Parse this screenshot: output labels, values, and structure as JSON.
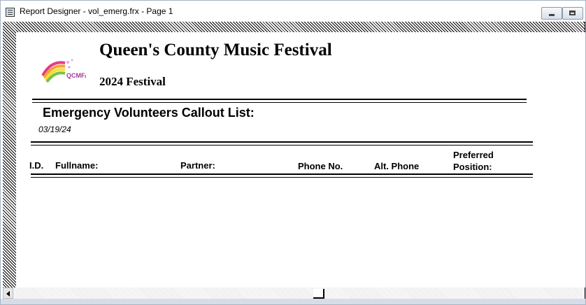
{
  "window": {
    "title": "Report Designer - vol_emerg.frx - Page 1"
  },
  "report": {
    "title": "Queen's County Music Festival",
    "subtitle": "2024 Festival",
    "logo_text": "QCMFA",
    "list_title": "Emergency Volunteers Callout List:",
    "date": "03/19/24",
    "columns": {
      "id": "I.D.",
      "fullname": "Fullname:",
      "partner": "Partner:",
      "phone": "Phone No.",
      "alt_phone": "Alt. Phone",
      "preferred_1": "Preferred",
      "preferred_2": "Position:"
    }
  },
  "colors": {
    "hatch": "#000000",
    "page_background": "#ffffff"
  }
}
